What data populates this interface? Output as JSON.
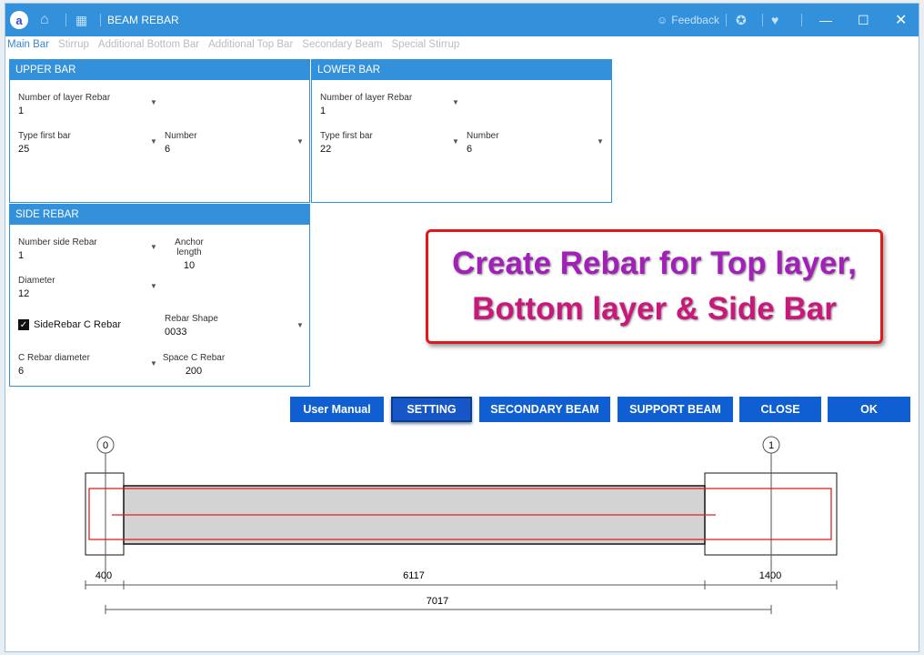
{
  "window": {
    "title": "BEAM REBAR",
    "feedback": "Feedback"
  },
  "tabs": [
    "Main Bar",
    "Stirrup",
    "Additional Bottom Bar",
    "Additional Top Bar",
    "Secondary Beam",
    "Special Stirrup"
  ],
  "upper_bar": {
    "header": "UPPER BAR",
    "layer_label": "Number of layer Rebar",
    "layer_value": "1",
    "type_label": "Type first bar",
    "type_value": "25",
    "number_label": "Number",
    "number_value": "6"
  },
  "lower_bar": {
    "header": "LOWER BAR",
    "layer_label": "Number of layer Rebar",
    "layer_value": "1",
    "type_label": "Type first bar",
    "type_value": "22",
    "number_label": "Number",
    "number_value": "6"
  },
  "side_rebar": {
    "header": "SIDE REBAR",
    "number_label": "Number side Rebar",
    "number_value": "1",
    "anchor_label": "Anchor length",
    "anchor_value": "10",
    "diameter_label": "Diameter",
    "diameter_value": "12",
    "c_rebar_label": "SideRebar C Rebar",
    "c_rebar_checked": true,
    "shape_label": "Rebar Shape",
    "shape_value": "0033",
    "c_diam_label": "C Rebar diameter",
    "c_diam_value": "6",
    "space_label": "Space C Rebar",
    "space_value": "200"
  },
  "buttons": {
    "manual": "User Manual",
    "setting": "SETTING",
    "secondary": "SECONDARY BEAM",
    "support": "SUPPORT BEAM",
    "close": "CLOSE",
    "ok": "OK"
  },
  "callout": {
    "line1": "Create Rebar for Top layer,",
    "line2": "Bottom layer & Side Bar"
  },
  "drawing": {
    "axis_left": "0",
    "axis_right": "1",
    "dim_left": "400",
    "dim_span": "6117",
    "dim_right": "1400",
    "dim_total": "7017"
  }
}
